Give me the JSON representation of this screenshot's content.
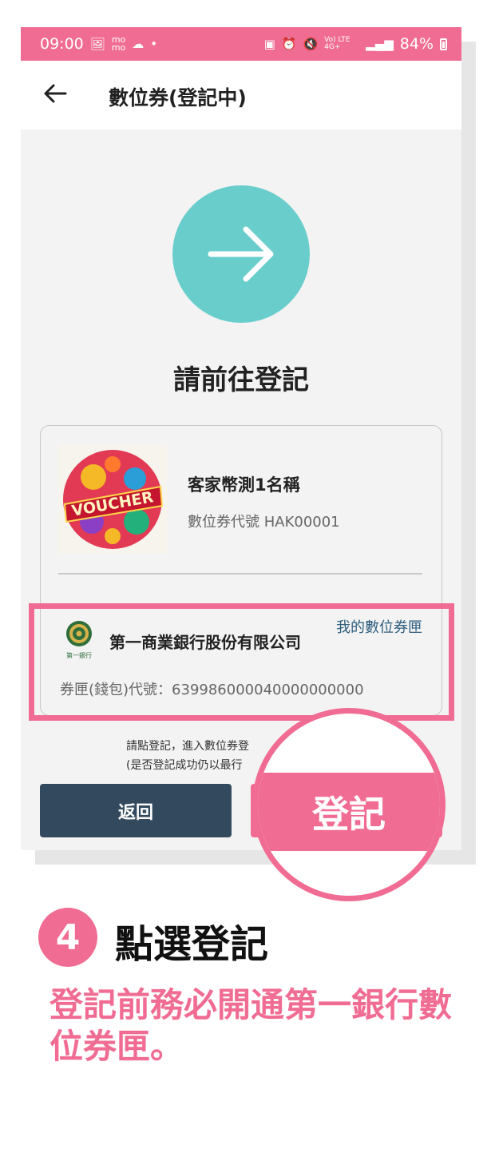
{
  "status_bar": {
    "time": "09:00",
    "left_icons": [
      "image-icon",
      "mo-icon",
      "cloud-icon",
      "dot-icon"
    ],
    "network": "Vo) LTE 4G+",
    "battery_percent": "84%"
  },
  "app_bar": {
    "title": "數位券(登記中)"
  },
  "hero": {
    "heading": "請前往登記"
  },
  "voucher": {
    "image_text": "VOUCHER",
    "name": "客家幣測1名稱",
    "code_line": "數位券代號 HAK00001"
  },
  "bank": {
    "logo_caption": "第一銀行",
    "name": "第一商業銀行股份有限公司",
    "wallet_link": "我的數位券匣",
    "wallet_code_line": "券匣(錢包)代號：639986000040000000000"
  },
  "hint": {
    "line1": "請點登記，進入數位券登",
    "line2": "(是否登記成功仍以最行"
  },
  "buttons": {
    "back": "返回",
    "register": "登記"
  },
  "instruction": {
    "step_number": "4",
    "step_title": "點選登記",
    "description": "登記前務必開通第一銀行數位券匣。"
  },
  "colors": {
    "accent_pink": "#f06c93",
    "teal": "#68cdcb",
    "dark_button": "#334a5e",
    "link_blue": "#2f5e7e"
  }
}
